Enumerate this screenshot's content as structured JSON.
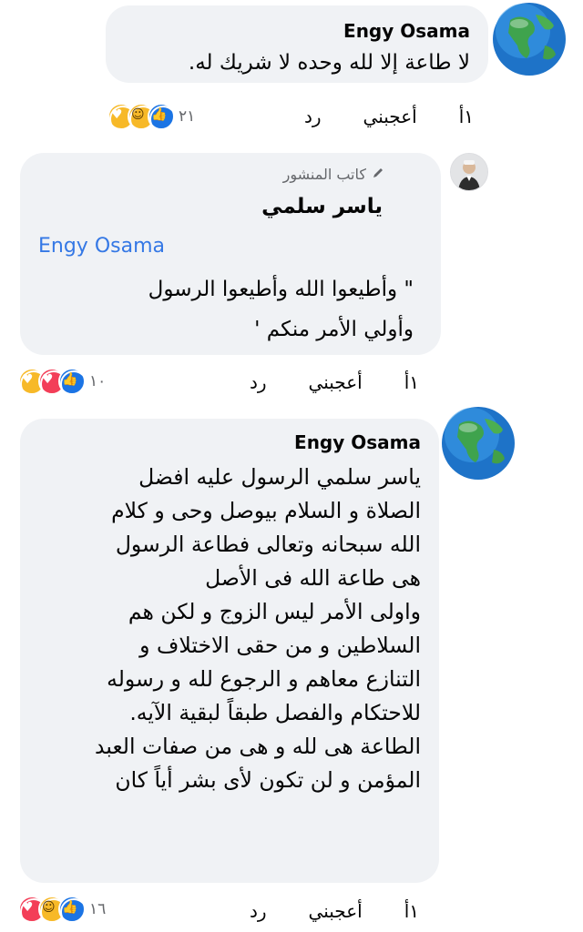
{
  "comments": [
    {
      "author": "Engy Osama",
      "text": "لا طاعة إلا لله وحده لا شريك له.",
      "actions": {
        "time": "١أ",
        "like": "أعجبني",
        "reply": "رد"
      },
      "reactions": {
        "count": "٢١",
        "icons": [
          "care-icon",
          "haha-icon",
          "like-icon"
        ]
      }
    },
    {
      "badge": "كاتب المنشور",
      "author": "ياسر سلمي",
      "mention": "Engy Osama",
      "text": "\" وأطيعوا الله وأطيعوا الرسول\nوأولي الأمر منكم '",
      "actions": {
        "time": "١أ",
        "like": "أعجبني",
        "reply": "رد"
      },
      "reactions": {
        "count": "١٠",
        "icons": [
          "care-icon",
          "love-icon",
          "like-icon"
        ]
      }
    },
    {
      "author": "Engy Osama",
      "text": "ياسر سلمي الرسول  عليه افضل\nالصلاة و السلام بيوصل وحى و كلام\nالله سبحانه وتعالى فطاعة الرسول\nهى طاعة الله فى الأصل\nواولى الأمر ليس الزوج و لكن هم\nالسلاطين و من حقى الاختلاف و\nالتنازع معاهم و الرجوع لله و رسوله\nللاحتكام والفصل طبقاً لبقية الآيه.\nالطاعة هى لله و هى من صفات العبد\nالمؤمن و لن تكون لأى بشر أياً كان",
      "actions": {
        "time": "١أ",
        "like": "أعجبني",
        "reply": "رد"
      },
      "reactions": {
        "count": "١٦",
        "icons": [
          "love-icon",
          "haha-icon",
          "like-icon"
        ]
      }
    }
  ]
}
